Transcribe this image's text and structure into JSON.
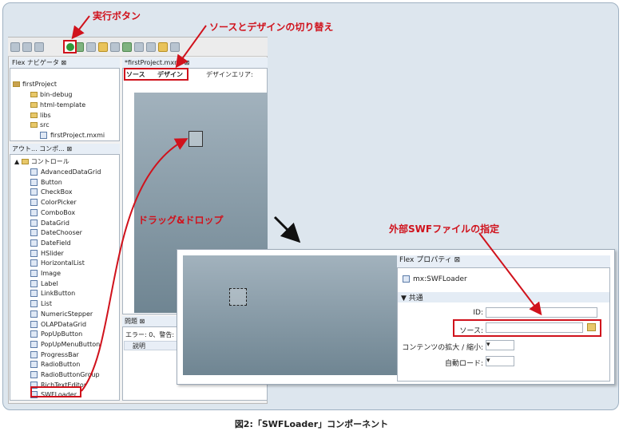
{
  "callouts": {
    "run_button": "実行ボタン",
    "source_design_toggle": "ソースとデザインの切り替え",
    "drag_drop": "ドラッグ&ドロップ",
    "external_swf": "外部SWFファイルの指定"
  },
  "navigator": {
    "tab": "Flex ナビゲータ",
    "project": "firstProject",
    "folders": [
      "bin-debug",
      "html-template",
      "libs",
      "src"
    ],
    "file": "firstProject.mxmi"
  },
  "components_panel": {
    "tab_outline": "アウト...",
    "tab_components": "コンポ...",
    "category": "コントロール",
    "items": [
      "AdvancedDataGrid",
      "Button",
      "CheckBox",
      "ColorPicker",
      "ComboBox",
      "DataGrid",
      "DateChooser",
      "DateField",
      "HSlider",
      "HorizontalList",
      "Image",
      "Label",
      "LinkButton",
      "List",
      "NumericStepper",
      "OLAPDataGrid",
      "PopUpButton",
      "PopUpMenuButton",
      "ProgressBar",
      "RadioButton",
      "RadioButtonGroup",
      "RichTextEditor",
      "SWFLoader"
    ]
  },
  "editor": {
    "tab": "*firstProject.mxml",
    "source_btn": "ソース",
    "design_btn": "デザイン",
    "design_area_label": "デザインエリア:"
  },
  "problems": {
    "tab": "問題",
    "summary": "エラー: 0、警告: 0",
    "column": "説明"
  },
  "properties": {
    "tab": "Flex プロパティ",
    "component": "mx:SWFLoader",
    "section": "共通",
    "fields": {
      "id": "ID:",
      "source": "ソース:",
      "scale": "コンテンツの拡大 / 縮小:",
      "autoload": "自動ロード:"
    }
  },
  "caption": "図2:「SWFLoader」コンポーネント"
}
